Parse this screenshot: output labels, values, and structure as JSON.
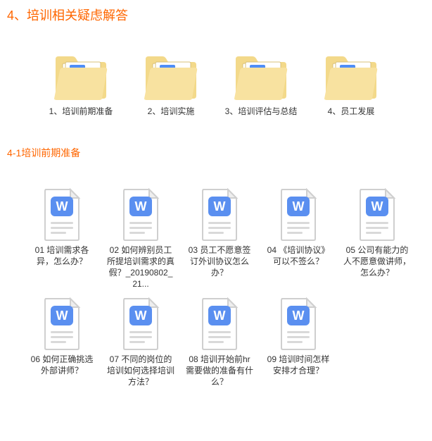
{
  "section_title": "4、培训相关疑虑解答",
  "folders": [
    {
      "label": "1、培训前期准备"
    },
    {
      "label": "2、培训实施"
    },
    {
      "label": "3、培训评估与总结"
    },
    {
      "label": "4、员工发展"
    }
  ],
  "sub_title": "4-1培训前期准备",
  "files": [
    {
      "label": "01 培训需求各异，怎么办？"
    },
    {
      "label": "02 如何辨别员工所提培训需求的真假？_20190802_21..."
    },
    {
      "label": "03 员工不愿意签订外训协议怎么办？"
    },
    {
      "label": "04 《培训协议》可以不签么？"
    },
    {
      "label": "05 公司有能力的人不愿意做讲师，怎么办？"
    },
    {
      "label": "06 如何正确挑选外部讲师？"
    },
    {
      "label": "07 不同的岗位的培训如何选择培训方法？"
    },
    {
      "label": "08 培训开始前hr需要做的准备有什么？"
    },
    {
      "label": "09 培训时间怎样安排才合理？"
    }
  ]
}
